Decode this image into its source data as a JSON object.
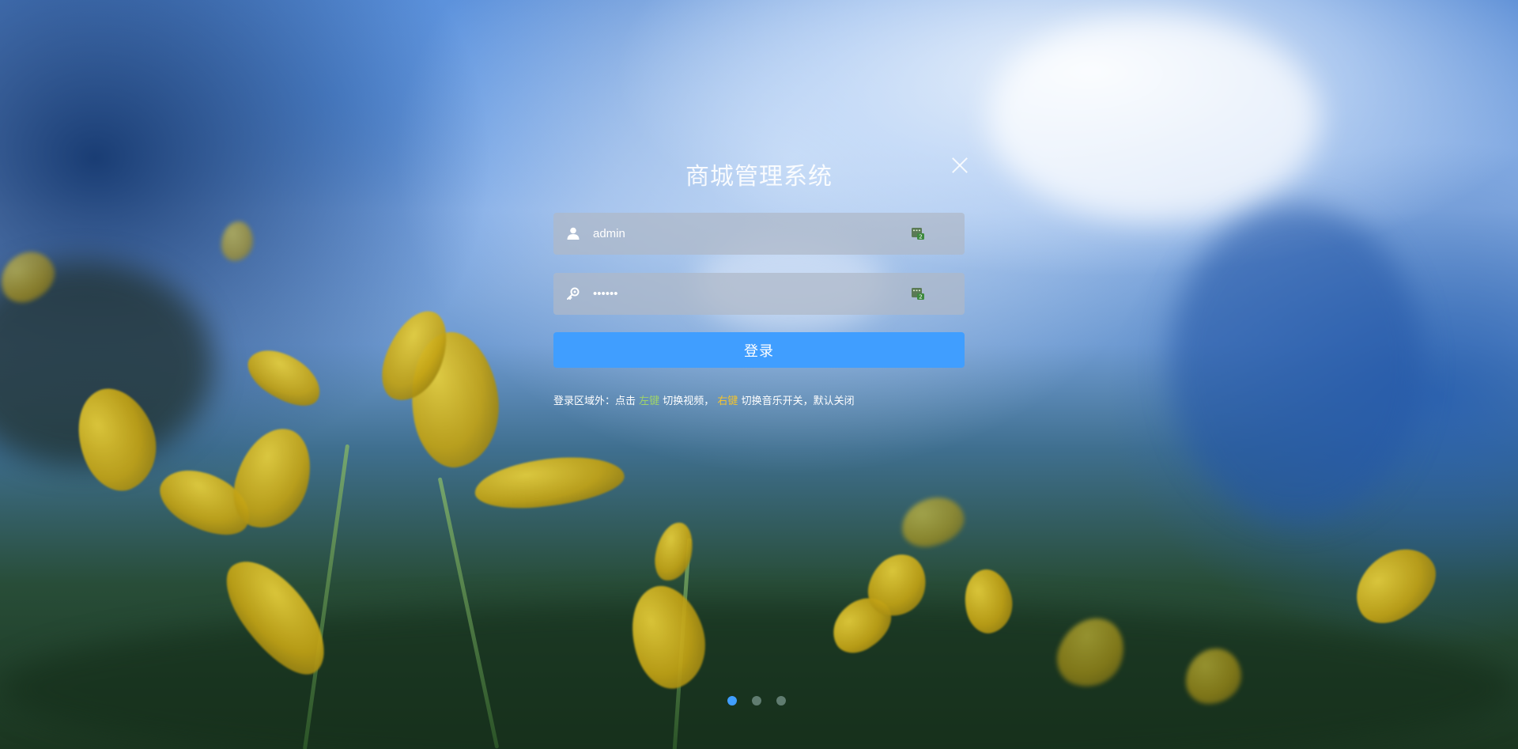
{
  "login": {
    "title": "商城管理系统",
    "username_value": "admin",
    "password_value": "••••••",
    "login_label": "登录",
    "hint": {
      "prefix": "登录区域外：点击 ",
      "left_key": "左键",
      "mid": " 切换视频， ",
      "right_key": "右键",
      "suffix": " 切换音乐开关，默认关闭"
    }
  },
  "icons": {
    "username": "user-icon",
    "password": "key-icon",
    "keyboard": "keyboard-icon",
    "close": "close-icon"
  },
  "carousel": {
    "count": 3,
    "active_index": 0
  },
  "colors": {
    "accent": "#409eff",
    "left_key": "#9ed36a",
    "right_key": "#f2c32f"
  }
}
